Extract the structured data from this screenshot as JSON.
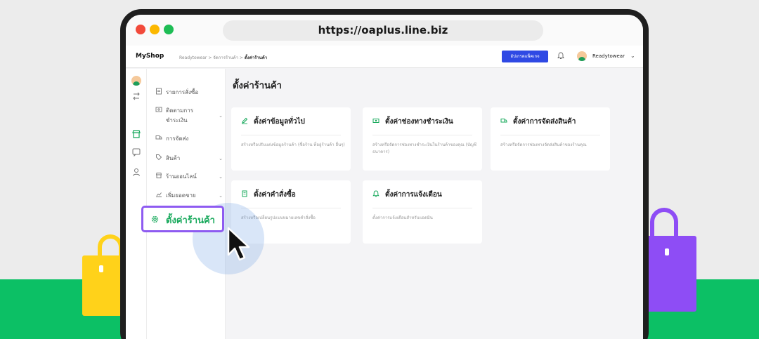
{
  "browser": {
    "url": "https://oaplus.line.biz"
  },
  "app": {
    "shop_name": "MyShop",
    "breadcrumb": {
      "root": "Readytowear",
      "sep1": ">",
      "middle": "จัดการร้านค้า",
      "sep2": ">",
      "current": "ตั้งค่าร้านค้า"
    },
    "upgrade_label": "อัปเกรดแพ็คเกจ",
    "user_name": "Readytowear",
    "user_chevron": "⌄"
  },
  "sidebar": {
    "items": [
      {
        "label": "รายการสั่งซื้อ",
        "chevron": ""
      },
      {
        "label": "ติดตามการ",
        "label2": "ชำระเงิน",
        "chevron": "⌄"
      },
      {
        "label": "การจัดส่ง",
        "chevron": ""
      },
      {
        "label": "สินค้า",
        "chevron": "⌄"
      },
      {
        "label": "ร้านออนไลน์",
        "chevron": "⌄"
      },
      {
        "label": "เพิ่มยอดขาย",
        "chevron": "⌄"
      }
    ],
    "active_label": "ตั้งค่าร้านค้า"
  },
  "main": {
    "title": "ตั้งค่าร้านค้า",
    "cards": [
      {
        "title": "ตั้งค่าข้อมูลทั่วไป",
        "desc": "สร้างหรือปรับแต่งข้อมูลร้านค้า (ชื่อร้าน ที่อยู่ร้านค้า อื่นๆ)"
      },
      {
        "title": "ตั้งค่าช่องทางชำระเงิน",
        "desc": "สร้างหรือจัดการช่องทางชำระเงินในร้านค้าของคุณ (บัญชีธนาคาร)"
      },
      {
        "title": "ตั้งค่าการจัดส่งสินค้า",
        "desc": "สร้างหรือจัดการช่องทางจัดส่งสินค้าของร้านคุณ"
      },
      {
        "title": "ตั้งค่าคำสั่งซื้อ",
        "desc": "สร้างหรือเปลี่ยนรูปแบบหมายเลขคำสั่งซื้อ"
      },
      {
        "title": "ตั้งค่าการแจ้งเตือน",
        "desc": "ตั้งค่าการแจ้งเตือนสำหรับแอดมิน"
      }
    ]
  },
  "colors": {
    "accent_green": "#15a85a",
    "highlight_purple": "#8e5bf1",
    "upgrade_blue": "#2f49e4",
    "ground_green": "#0cc065",
    "bag_yellow": "#ffd21a",
    "bag_purple": "#8e4df5"
  }
}
